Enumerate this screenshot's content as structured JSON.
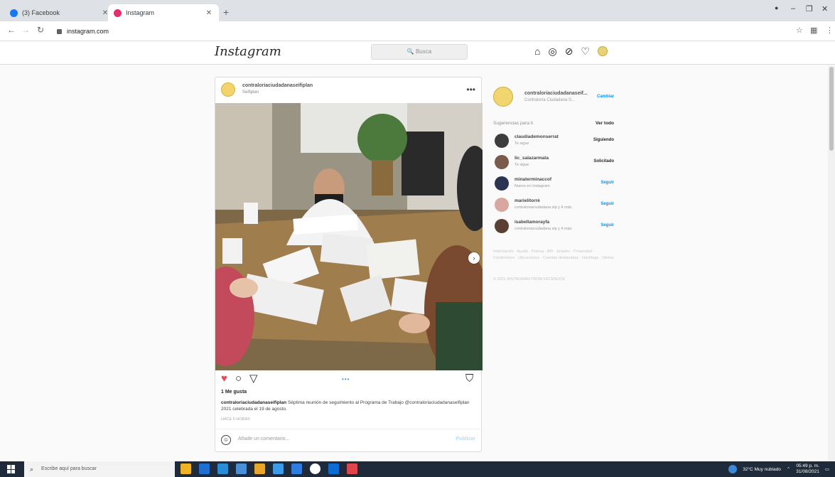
{
  "browser": {
    "tabs": [
      {
        "label": "(3) Facebook",
        "active": false,
        "favicon_color": "#1877f2"
      },
      {
        "label": "Instagram",
        "active": true,
        "favicon_color": "#e1306c"
      }
    ],
    "new_tab": "+",
    "url": "instagram.com",
    "window_controls": {
      "minimize": "–",
      "maximize": "❐",
      "close": "✕"
    }
  },
  "instagram": {
    "logo": "Instagram",
    "search_placeholder": "🔍 Busca",
    "nav_icons": [
      "home-icon",
      "messenger-icon",
      "explore-icon",
      "heart-icon",
      "profile-avatar"
    ]
  },
  "post": {
    "username": "contraloriaciudadanaseifiplan",
    "location": "Seifiplan",
    "more": "•••",
    "likes": "1 Me gusta",
    "caption_user": "contraloriaciudadanaseifiplan",
    "caption_text": "Séptima reunión de seguimiento al Programa de Trabajo @contraloriaciudadanaseifiplan 2021 celebrada el 19 de agosto.",
    "time": "HACE 6 HORAS",
    "comment_placeholder": "Añade un comentario...",
    "publish": "Publicar",
    "carousel_dots": "•••",
    "liked": true,
    "accent_like": "#ed4956"
  },
  "sidebar": {
    "me_username": "contraloriaciudadanaseif...",
    "me_fullname": "Contraloría Ciudadana S...",
    "switch": "Cambiar",
    "suggestions_title": "Sugerencias para ti",
    "see_all": "Ver todo",
    "suggestions": [
      {
        "name": "claudiademonserrat",
        "sub": "Te sigue",
        "action": "Siguiendo",
        "color": "#3d3d3d"
      },
      {
        "name": "lic_salazarmata",
        "sub": "Te sigue",
        "action": "Solicitado",
        "color": "#7a5a4a"
      },
      {
        "name": "minaterminaccof",
        "sub": "Nuevo en Instagram",
        "action": "Seguir",
        "color": "#2b3552"
      },
      {
        "name": "marielitorrè",
        "sub": "contraloriaciudadana.slp y 4 más",
        "action": "Seguir",
        "color": "#d8a8a0"
      },
      {
        "name": "isabellamorayfa",
        "sub": "contraloriaciudadana.slp y 4 más",
        "action": "Seguir",
        "color": "#5a4033"
      }
    ],
    "footer_links": "Información · Ayuda · Prensa · API · Empleo · Privacidad · Condiciones · Ubicaciones · Cuentas destacadas · Hashtags · Idioma",
    "copyright": "© 2021 INSTAGRAM FROM FACEBOOK"
  },
  "taskbar": {
    "search_placeholder": "Escribe aquí para buscar",
    "weather": "32°C Muy nublado",
    "time": "05:49 p. m.",
    "date": "31/08/2021",
    "apps": [
      "#f0b323",
      "#1e6fd0",
      "#2a8bd8",
      "#4a90d9",
      "#e8a72a",
      "#3c9be8",
      "#2f7de0",
      "#ffffff",
      "#0c6cd4",
      "#e0444c"
    ]
  }
}
